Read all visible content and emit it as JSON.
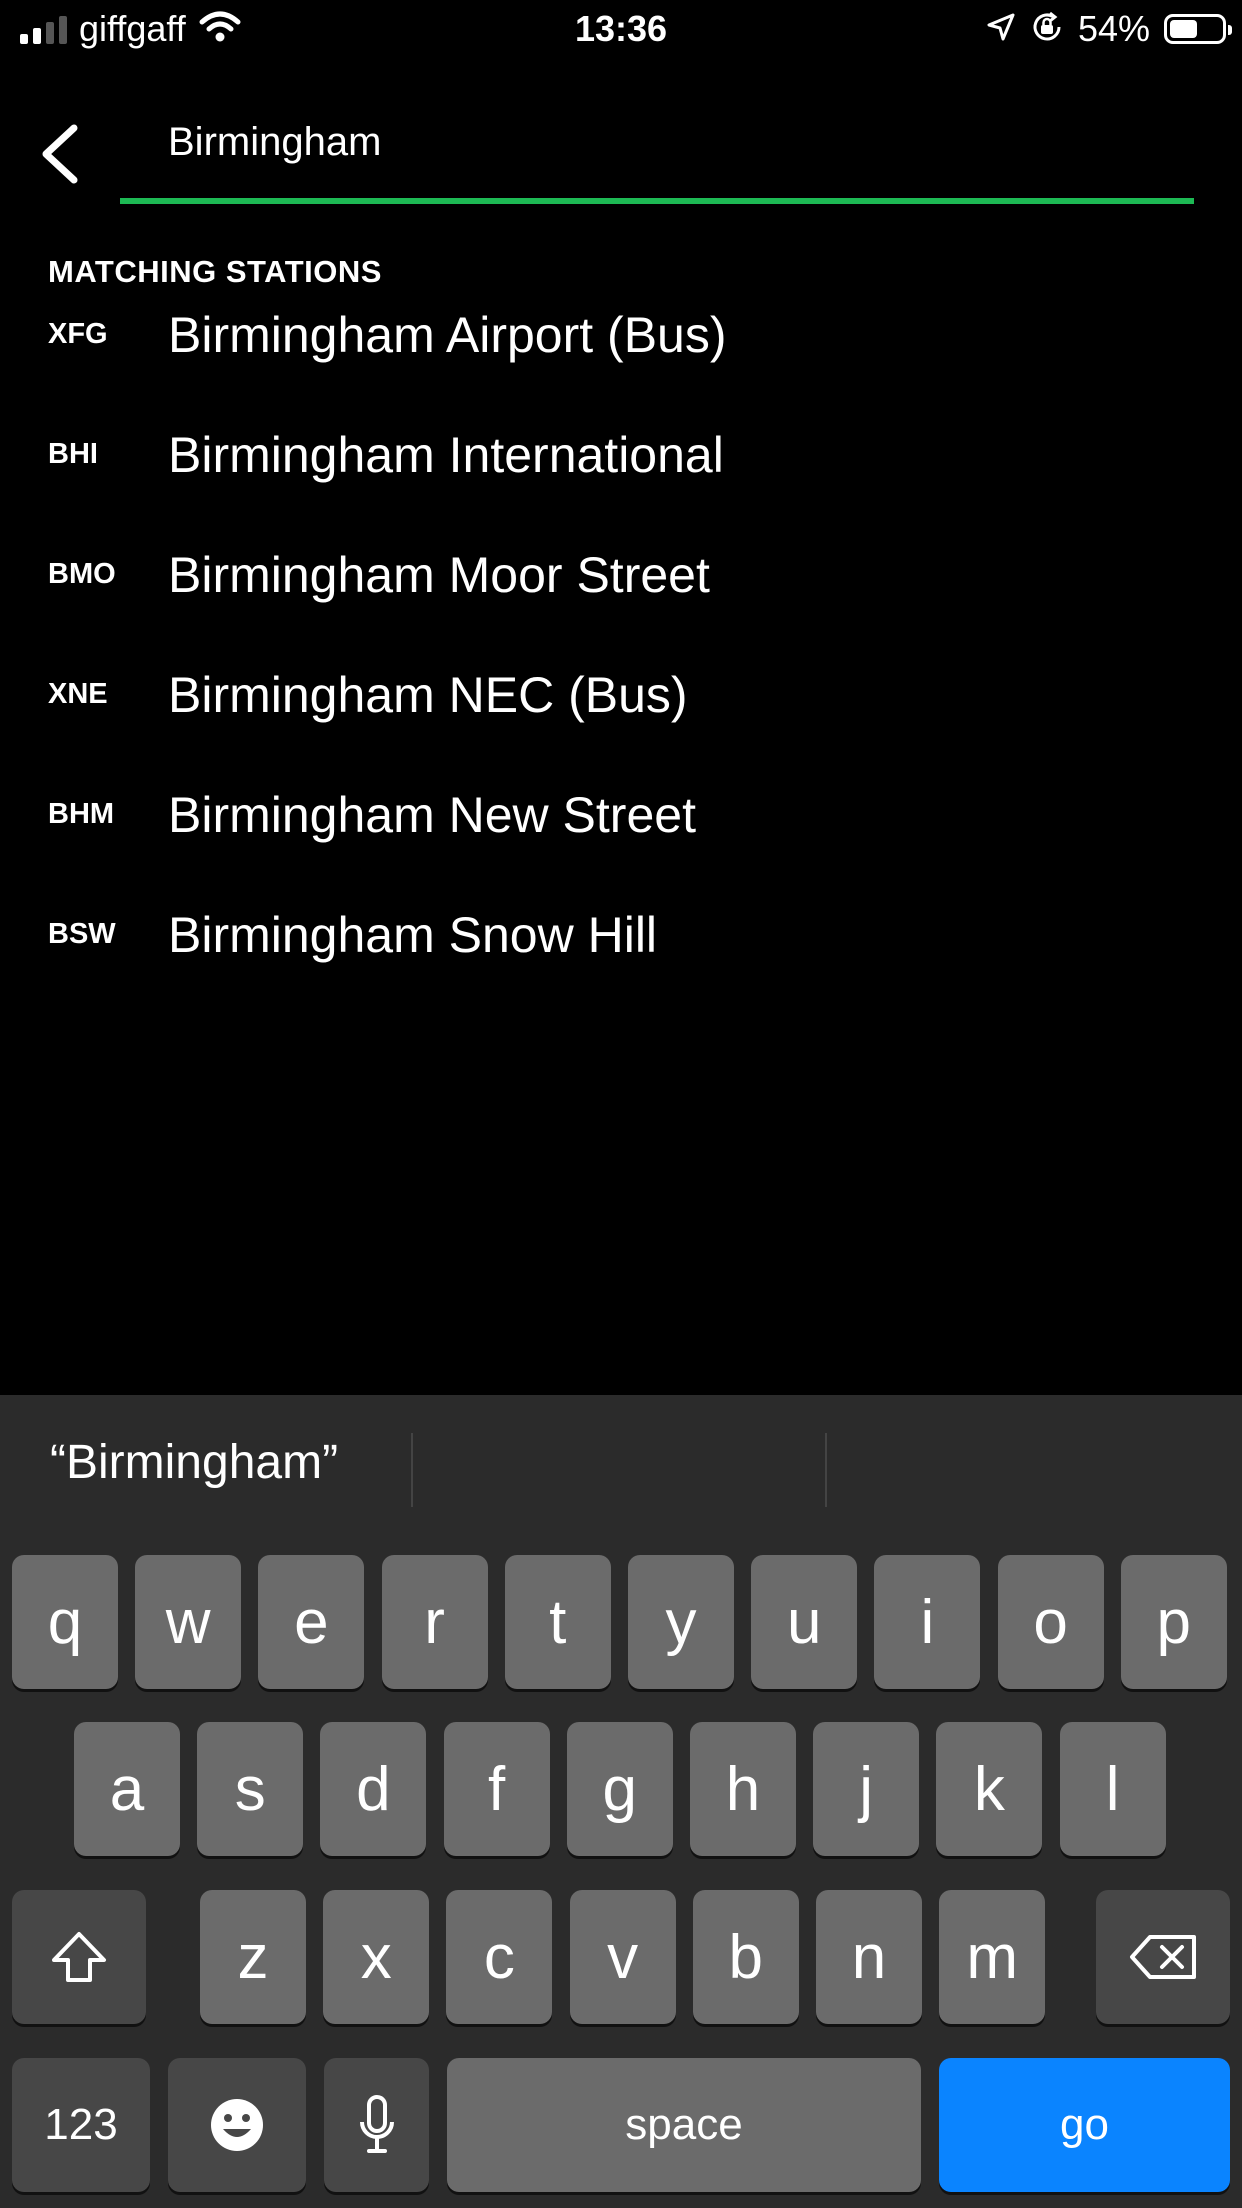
{
  "status_bar": {
    "carrier": "giffgaff",
    "time": "13:36",
    "battery_percent": "54%",
    "battery_level": 0.54,
    "signal_bars": 2
  },
  "search": {
    "value": "Birmingham",
    "accent_color": "#1db954"
  },
  "results": {
    "section_label": "MATCHING STATIONS",
    "items": [
      {
        "code": "XFG",
        "name": "Birmingham Airport (Bus)"
      },
      {
        "code": "BHI",
        "name": "Birmingham International"
      },
      {
        "code": "BMO",
        "name": "Birmingham Moor Street"
      },
      {
        "code": "XNE",
        "name": "Birmingham NEC (Bus)"
      },
      {
        "code": "BHM",
        "name": "Birmingham New Street"
      },
      {
        "code": "BSW",
        "name": "Birmingham Snow Hill"
      }
    ]
  },
  "keyboard": {
    "prediction": "“Birmingham”",
    "row1": [
      "q",
      "w",
      "e",
      "r",
      "t",
      "y",
      "u",
      "i",
      "o",
      "p"
    ],
    "row2": [
      "a",
      "s",
      "d",
      "f",
      "g",
      "h",
      "j",
      "k",
      "l"
    ],
    "row3": [
      "z",
      "x",
      "c",
      "v",
      "b",
      "n",
      "m"
    ],
    "numbers_label": "123",
    "space_label": "space",
    "go_label": "go",
    "go_color": "#0a84ff"
  }
}
